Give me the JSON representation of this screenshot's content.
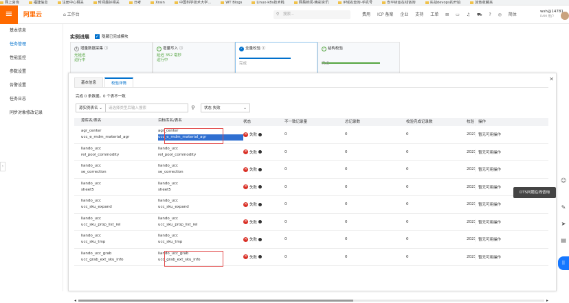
{
  "bookmarks": [
    "网上咨询",
    "福建信息",
    "注册中心相关",
    "时间最好相关",
    "日考",
    "Xrain",
    "中国科学技术大学...",
    "WT Blogs",
    "Linux-k8s技术栈",
    "网易新闻-精彩资讯",
    "IP域名查询-手机号",
    "安平树亚在线咨询",
    "实战devops的开始",
    "其他收藏夹"
  ],
  "header": {
    "logo": "阿里云",
    "workspace": "工作台",
    "search_placeholder": "搜索...",
    "nav": [
      "费用",
      "ICP 备案",
      "企业",
      "支持",
      "工单"
    ],
    "icons": [
      "grid-icon",
      "screen-icon",
      "bell-icon",
      "cart-icon",
      "help-icon",
      "globe-icon"
    ],
    "lang": "简体",
    "user": "wsh@14781...",
    "user_sub": "RAM 用户"
  },
  "sidebar": {
    "items": [
      {
        "label": "基本信息"
      },
      {
        "label": "任务管理"
      },
      {
        "label": "性能监控"
      },
      {
        "label": "参数设置"
      },
      {
        "label": "告警设置"
      },
      {
        "label": "任务日志"
      },
      {
        "label": "同步对象修改记录"
      }
    ],
    "active": 1
  },
  "progress": {
    "title": "实例进展",
    "hide_done": "隐藏已完成模块",
    "steps": [
      {
        "num": "1",
        "title": "增量数据采集",
        "line1": "无延迟",
        "line2": "运行中"
      },
      {
        "title": "增量写入",
        "line1": "延迟 352 毫秒",
        "line2": "运行中"
      },
      {
        "title": "全量校验",
        "line1": "完成"
      },
      {
        "title": "结构校验",
        "line1": "完成"
      }
    ]
  },
  "dialog": {
    "tabs": [
      "基本信息",
      "校验详情"
    ],
    "active_tab": 1,
    "summary": "完成 0 条数据。0 个表不一致",
    "filter": {
      "select": "源实例表名",
      "placeholder": "请选择类型后输入搜索",
      "status_label": "状态",
      "status_value": "失败"
    },
    "columns": [
      "源库名/表名",
      "目标库名/表名",
      "状态",
      "不一致记录量",
      "总记录数",
      "校验完成记录数",
      "校验",
      "操作"
    ],
    "rows": [
      {
        "src_db": "agr_center",
        "src_tbl": "ucc_e_mdm_material_agr",
        "dst_db": "agr_center",
        "dst_tbl": "ucc_e_mdm_material_agr",
        "status": "失败",
        "diff": "0",
        "total": "0",
        "checked": "0",
        "year": "2023",
        "action": "暂无可用操作"
      },
      {
        "src_db": "liando_ucc",
        "src_tbl": "rel_pool_commodity",
        "dst_db": "liando_ucc",
        "dst_tbl": "rel_pool_commodity",
        "status": "失败",
        "diff": "0",
        "total": "0",
        "checked": "0",
        "year": "2023",
        "action": "暂无可用操作"
      },
      {
        "src_db": "liando_ucc",
        "src_tbl": "se_correction",
        "dst_db": "liando_ucc",
        "dst_tbl": "se_correction",
        "status": "失败",
        "diff": "0",
        "total": "0",
        "checked": "0",
        "year": "2023",
        "action": "暂无可用操作"
      },
      {
        "src_db": "liando_ucc",
        "src_tbl": "sheet5",
        "dst_db": "liando_ucc",
        "dst_tbl": "sheet5",
        "status": "失败",
        "diff": "0",
        "total": "0",
        "checked": "0",
        "year": "2023",
        "action": "暂无可用操作"
      },
      {
        "src_db": "liando_ucc",
        "src_tbl": "ucc_sku_expand",
        "dst_db": "liando_ucc",
        "dst_tbl": "ucc_sku_expand",
        "status": "失败",
        "diff": "0",
        "total": "0",
        "checked": "0",
        "year": "2023",
        "action": "暂无可用操作"
      },
      {
        "src_db": "liando_ucc",
        "src_tbl": "ucc_sku_prop_list_rel",
        "dst_db": "liando_ucc",
        "dst_tbl": "ucc_sku_prop_list_rel",
        "status": "失败",
        "diff": "0",
        "total": "0",
        "checked": "0",
        "year": "2023",
        "action": "暂无可用操作"
      },
      {
        "src_db": "liando_ucc",
        "src_tbl": "ucc_sku_tmp",
        "dst_db": "liando_ucc",
        "dst_tbl": "ucc_sku_tmp",
        "status": "失败",
        "diff": "0",
        "total": "0",
        "checked": "0",
        "year": "2023",
        "action": "暂无可用操作"
      },
      {
        "src_db": "liando_ucc_grab",
        "src_tbl": "ucc_grab_ext_sku_info",
        "dst_db": "liando_ucc_grab",
        "dst_tbl": "ucc_grab_ext_sku_info",
        "status": "失败",
        "diff": "0",
        "total": "0",
        "checked": "0",
        "year": "2023",
        "action": "暂无可用操作"
      }
    ]
  },
  "right_tools": {
    "tooltip": "DTS问题在线咨询"
  }
}
